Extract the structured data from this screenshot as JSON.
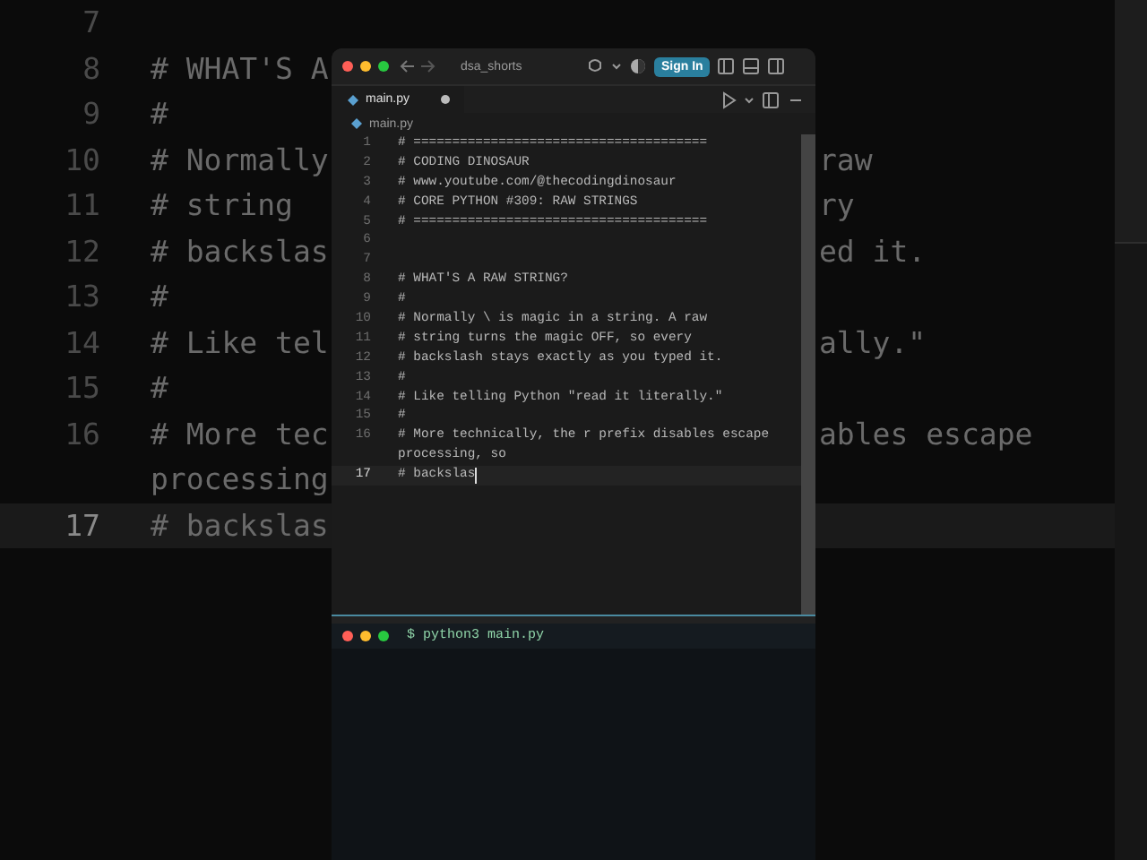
{
  "backdrop": {
    "lines": [
      {
        "number": "7",
        "current": false
      },
      {
        "number": "8",
        "left": "# WHAT'S A",
        "current": false
      },
      {
        "number": "9",
        "left": "#",
        "current": false
      },
      {
        "number": "10",
        "left": "# Normally",
        "right": "raw",
        "current": false
      },
      {
        "number": "11",
        "left": "# string",
        "right": "ry",
        "current": false
      },
      {
        "number": "12",
        "left": "# backslas",
        "right": "ed it.",
        "current": false
      },
      {
        "number": "13",
        "left": "#",
        "current": false
      },
      {
        "number": "14",
        "left": "# Like tel",
        "right": "ally.\"",
        "current": false
      },
      {
        "number": "15",
        "left": "#",
        "current": false
      },
      {
        "number": "16",
        "left": "# More tec",
        "right": "ables escape",
        "current": false
      },
      {
        "left": "processing",
        "current": false
      },
      {
        "number": "17",
        "left": "# backslas",
        "current": true
      }
    ]
  },
  "window": {
    "project": "dsa_shorts",
    "sign_in": "Sign In",
    "tabs": [
      {
        "label": "main.py",
        "selected": true,
        "modified": true
      }
    ],
    "breadcrumb": "main.py",
    "editor": {
      "lines": [
        {
          "number": "1",
          "text": "# ======================================",
          "current": false
        },
        {
          "number": "2",
          "text": "# CODING DINOSAUR",
          "current": false
        },
        {
          "number": "3",
          "text": "# www.youtube.com/@thecodingdinosaur",
          "current": false
        },
        {
          "number": "4",
          "text": "# CORE PYTHON #309: RAW STRINGS",
          "current": false
        },
        {
          "number": "5",
          "text": "# ======================================",
          "current": false
        },
        {
          "number": "6",
          "current": false
        },
        {
          "number": "7",
          "current": false
        },
        {
          "number": "8",
          "text": "# WHAT'S A RAW STRING?",
          "current": false
        },
        {
          "number": "9",
          "text": "#",
          "current": false
        },
        {
          "number": "10",
          "text": "# Normally \\ is magic in a string. A raw",
          "current": false
        },
        {
          "number": "11",
          "text": "# string turns the magic OFF, so every",
          "current": false
        },
        {
          "number": "12",
          "text": "# backslash stays exactly as you typed it.",
          "current": false
        },
        {
          "number": "13",
          "text": "#",
          "current": false
        },
        {
          "number": "14",
          "text": "# Like telling Python \"read it literally.\"",
          "current": false
        },
        {
          "number": "15",
          "text": "#",
          "current": false
        },
        {
          "number": "16",
          "text": "# More technically, the r prefix disables escape",
          "current": false
        },
        {
          "text": "processing, so",
          "current": false
        },
        {
          "number": "17",
          "text": "# backslas",
          "current": true
        }
      ]
    },
    "terminal": {
      "command": "$ python3 main.py"
    }
  }
}
